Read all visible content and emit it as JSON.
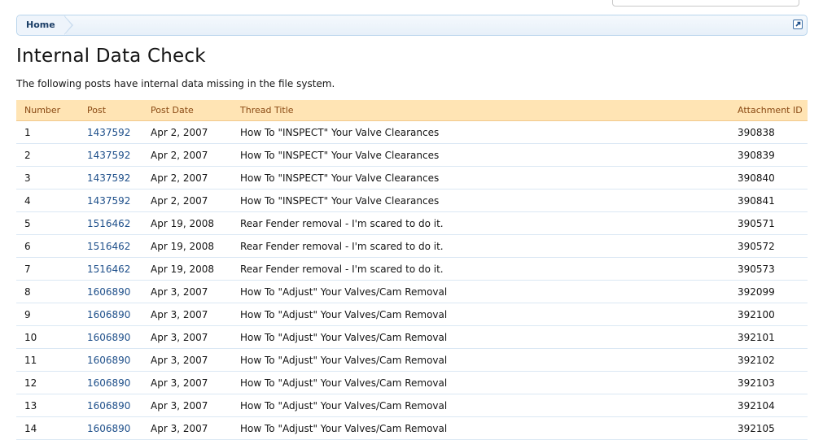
{
  "breadcrumb": {
    "home_label": "Home"
  },
  "page": {
    "title": "Internal Data Check",
    "description": "The following posts have internal data missing in the file system."
  },
  "table": {
    "headers": {
      "number": "Number",
      "post": "Post",
      "post_date": "Post Date",
      "thread_title": "Thread Title",
      "attachment_id": "Attachment ID"
    },
    "rows": [
      {
        "number": "1",
        "post": "1437592",
        "date": "Apr 2, 2007",
        "title": "How To \"INSPECT\" Your Valve Clearances",
        "attachment": "390838"
      },
      {
        "number": "2",
        "post": "1437592",
        "date": "Apr 2, 2007",
        "title": "How To \"INSPECT\" Your Valve Clearances",
        "attachment": "390839"
      },
      {
        "number": "3",
        "post": "1437592",
        "date": "Apr 2, 2007",
        "title": "How To \"INSPECT\" Your Valve Clearances",
        "attachment": "390840"
      },
      {
        "number": "4",
        "post": "1437592",
        "date": "Apr 2, 2007",
        "title": "How To \"INSPECT\" Your Valve Clearances",
        "attachment": "390841"
      },
      {
        "number": "5",
        "post": "1516462",
        "date": "Apr 19, 2008",
        "title": "Rear Fender removal - I'm scared to do it.",
        "attachment": "390571"
      },
      {
        "number": "6",
        "post": "1516462",
        "date": "Apr 19, 2008",
        "title": "Rear Fender removal - I'm scared to do it.",
        "attachment": "390572"
      },
      {
        "number": "7",
        "post": "1516462",
        "date": "Apr 19, 2008",
        "title": "Rear Fender removal - I'm scared to do it.",
        "attachment": "390573"
      },
      {
        "number": "8",
        "post": "1606890",
        "date": "Apr 3, 2007",
        "title": "How To \"Adjust\" Your Valves/Cam Removal",
        "attachment": "392099"
      },
      {
        "number": "9",
        "post": "1606890",
        "date": "Apr 3, 2007",
        "title": "How To \"Adjust\" Your Valves/Cam Removal",
        "attachment": "392100"
      },
      {
        "number": "10",
        "post": "1606890",
        "date": "Apr 3, 2007",
        "title": "How To \"Adjust\" Your Valves/Cam Removal",
        "attachment": "392101"
      },
      {
        "number": "11",
        "post": "1606890",
        "date": "Apr 3, 2007",
        "title": "How To \"Adjust\" Your Valves/Cam Removal",
        "attachment": "392102"
      },
      {
        "number": "12",
        "post": "1606890",
        "date": "Apr 3, 2007",
        "title": "How To \"Adjust\" Your Valves/Cam Removal",
        "attachment": "392103"
      },
      {
        "number": "13",
        "post": "1606890",
        "date": "Apr 3, 2007",
        "title": "How To \"Adjust\" Your Valves/Cam Removal",
        "attachment": "392104"
      },
      {
        "number": "14",
        "post": "1606890",
        "date": "Apr 3, 2007",
        "title": "How To \"Adjust\" Your Valves/Cam Removal",
        "attachment": "392105"
      }
    ]
  },
  "colors": {
    "header_bg": "#ffe4b4",
    "header_text": "#8a4a14",
    "link": "#1e4f8a",
    "breadcrumb_border": "#b8d4ec"
  },
  "icons": {
    "breadcrumb_jump": "external-link-icon"
  }
}
